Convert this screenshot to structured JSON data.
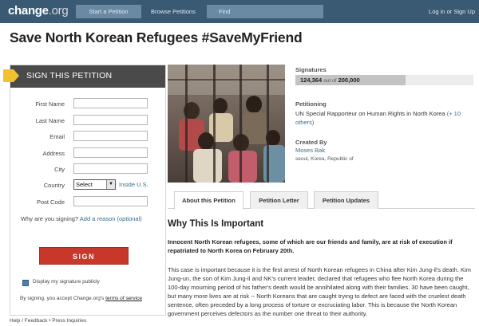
{
  "nav": {
    "logo": "change",
    "logo_suffix": ".org",
    "start_petition": "Start a Petition",
    "browse_petitions": "Browse Petitions",
    "find": "Find",
    "login": "Log in or Sign Up"
  },
  "petition": {
    "title": "Save North Korean Refugees #SaveMyFriend"
  },
  "sign_form": {
    "header": "SIGN THIS PETITION",
    "first_name_label": "First Name",
    "last_name_label": "Last Name",
    "email_label": "Email",
    "address_label": "Address",
    "city_label": "City",
    "country_label": "Country",
    "country_value": "Select",
    "inside_us": "Inside U.S.",
    "post_code_label": "Post Code",
    "why_signing": "Why are you signing?",
    "add_reason": "Add a reason (optional)",
    "sign_button": "SIGN",
    "display_signature": "Display my signature publicly",
    "terms_prefix": "By signing, you accept Change.org's",
    "terms_link": "terms of service"
  },
  "signatures": {
    "label": "Signatures",
    "count": "124,364",
    "of_text": "out of",
    "goal": "200,000",
    "progress_fraction": 0.62
  },
  "petitioning": {
    "label": "Petitioning",
    "target": "UN Special Rapporteur on Human Rights in North Korea",
    "more": "(+ 10 others)"
  },
  "created_by": {
    "label": "Created By",
    "name": "Moses Bak",
    "location": "seoul, Korea, Republic of"
  },
  "tabs": {
    "about": "About this Petition",
    "letter": "Petition Letter",
    "updates": "Petition Updates"
  },
  "content": {
    "heading": "Why This Is Important",
    "lede": "Innocent North Korean refugees, some of which are our friends and family, are at risk of execution if repatriated to North Korea on February 20th.",
    "body": "This case is important because it is the first arrest of North Korean refugees in China after Kim Jung-il's death. Kim Jung-un, the son of Kim Jung-il and NK's current leader, declared that refugees who flee North Korea during the 100-day mourning period of his father's death would be annihilated along with their families.   30 have been caught, but many more lives are at risk -- North Koreans that are caught trying to defect are faced with the cruelest death sentence, often preceded by a long process of torture or excruciating labor. This is because the North Korean government perceives defectors as the number one threat to their authority."
  },
  "footer": {
    "text": "Help / Feedback • Press Inquiries"
  },
  "colors": {
    "nav_bg": "#3a5a73",
    "sign_button": "#c8382a",
    "link": "#3a6d8c",
    "arrow": "#f2c12e"
  }
}
